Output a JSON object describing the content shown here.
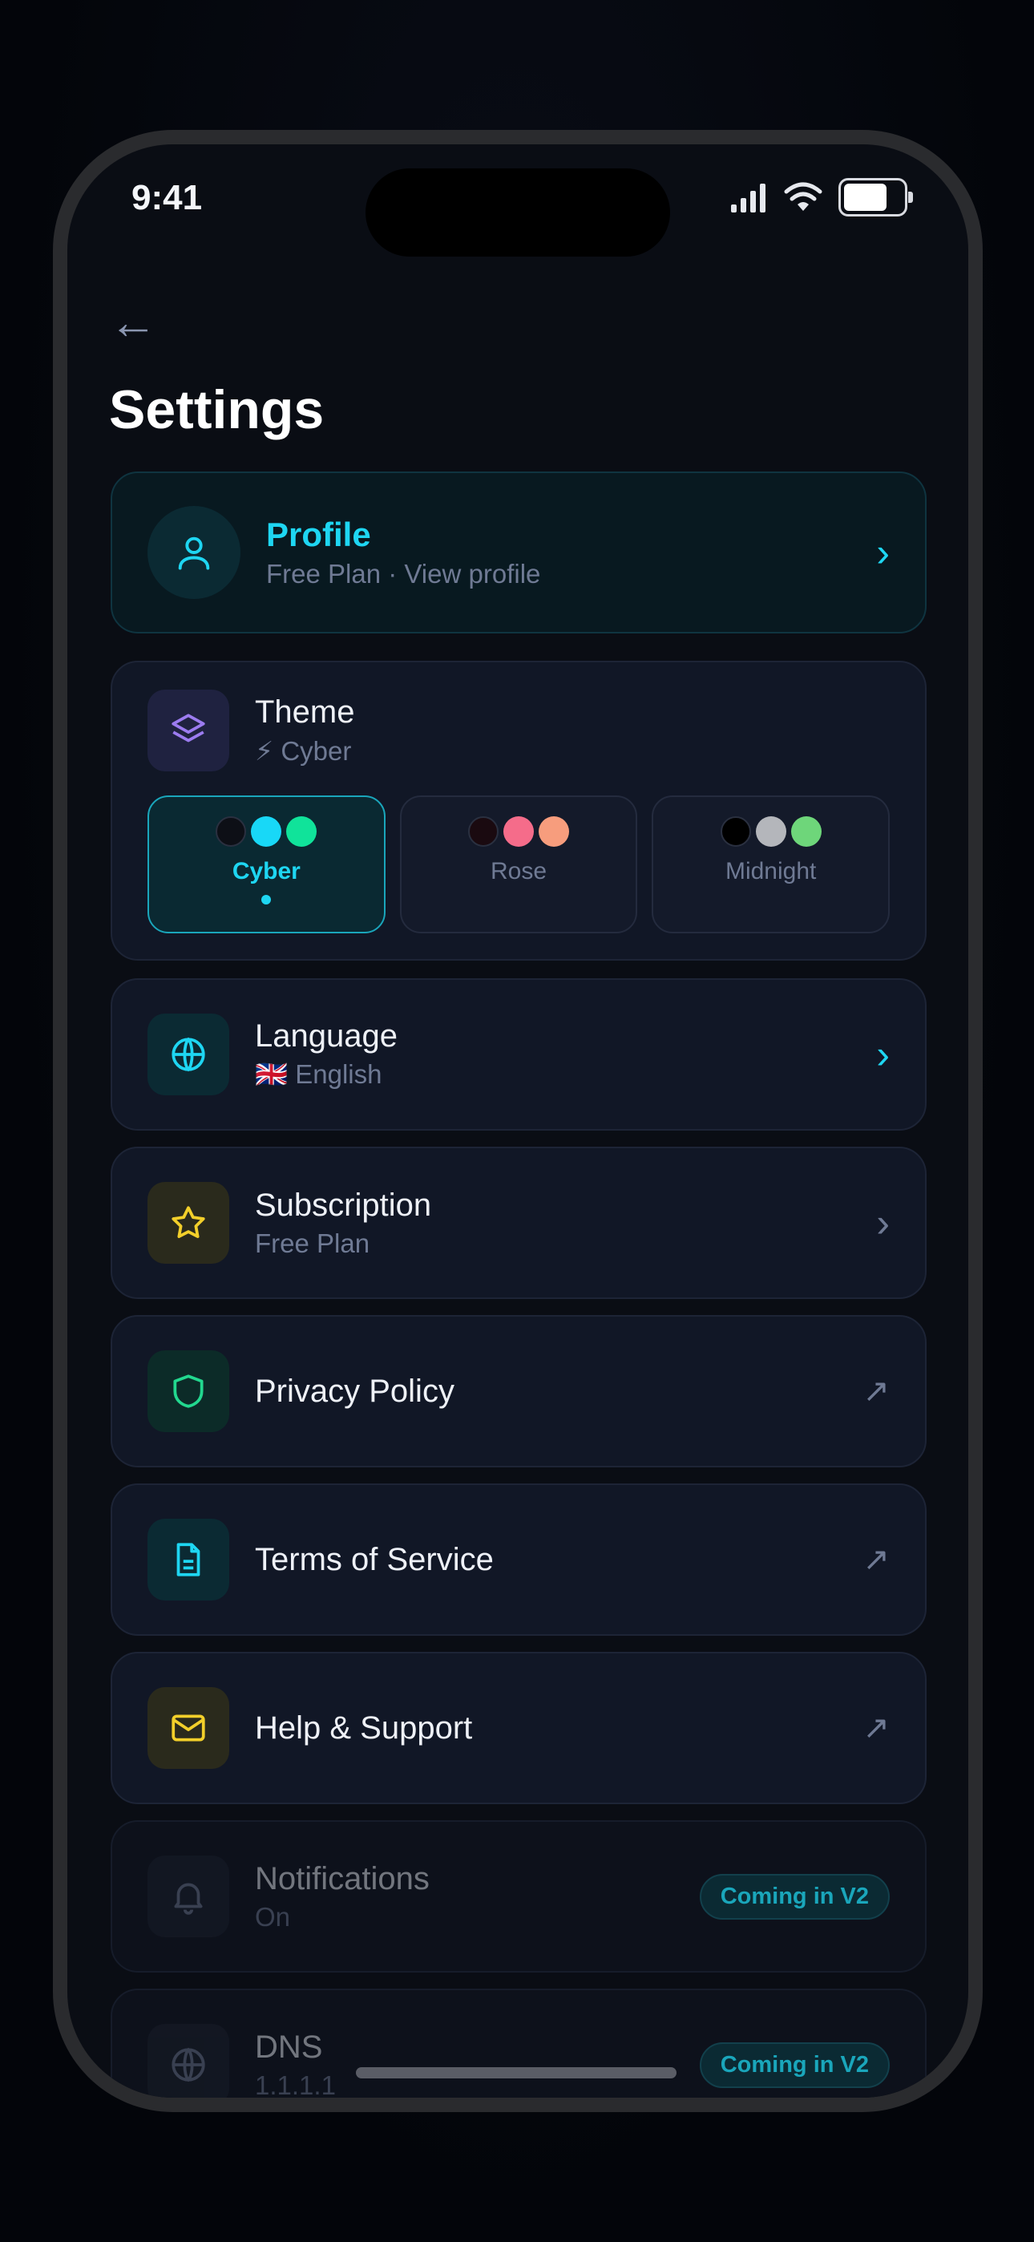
{
  "status_bar": {
    "time": "9:41"
  },
  "header": {
    "back_label": "←",
    "title": "Settings"
  },
  "profile": {
    "name": "Profile",
    "subtitle": "Free Plan · View profile",
    "chevron": "›"
  },
  "theme": {
    "label": "Theme",
    "current": "⚡ Cyber",
    "options": [
      {
        "name": "Cyber",
        "colors": [
          "#0d0f16",
          "#18d8f7",
          "#10e39a"
        ],
        "selected": true
      },
      {
        "name": "Rose",
        "colors": [
          "#1a0a10",
          "#f56c8a",
          "#f79d7d"
        ],
        "selected": false
      },
      {
        "name": "Midnight",
        "colors": [
          "#000000",
          "#b4b6bb",
          "#6ed67a"
        ],
        "selected": false
      }
    ]
  },
  "items": [
    {
      "label": "Language",
      "sub": "🇬🇧 English",
      "trail": "›",
      "icon": "globe-icon",
      "color": "#1ed6f2"
    },
    {
      "label": "Subscription",
      "sub": "Free Plan",
      "trail": "›",
      "icon": "star-icon",
      "color": "#f2cf2a"
    },
    {
      "label": "Privacy Policy",
      "sub": "",
      "trail": "↗",
      "icon": "shield-icon",
      "color": "#22d88f"
    },
    {
      "label": "Terms of Service",
      "sub": "",
      "trail": "↗",
      "icon": "document-icon",
      "color": "#1ed6f2"
    },
    {
      "label": "Help & Support",
      "sub": "",
      "trail": "↗",
      "icon": "mail-icon",
      "color": "#f2cf2a"
    }
  ],
  "coming": [
    {
      "label": "Notifications",
      "sub": "On",
      "badge": "Coming in V2",
      "icon": "bell-icon"
    },
    {
      "label": "DNS",
      "sub": "1.1.1.1",
      "badge": "Coming in V2",
      "icon": "globe-icon"
    }
  ]
}
